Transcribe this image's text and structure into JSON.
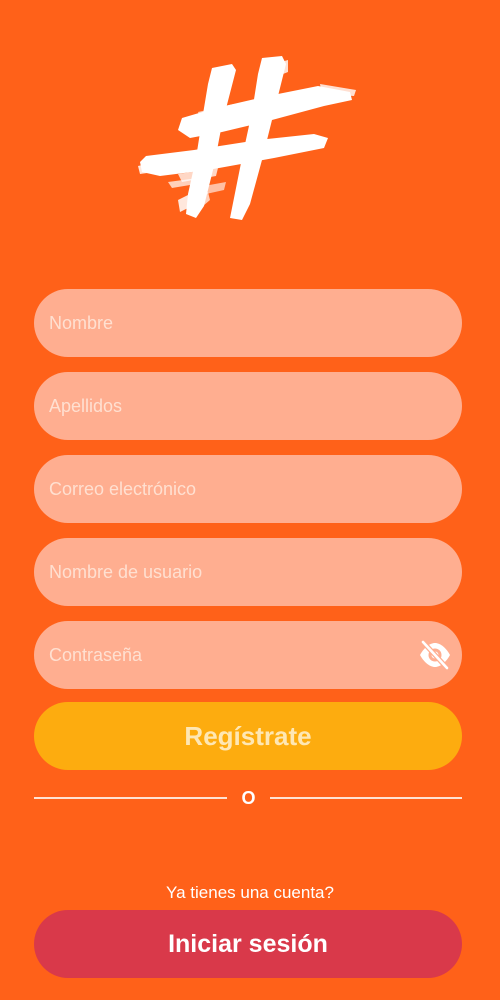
{
  "logo": {
    "icon": "hashtag-brush-logo-icon",
    "color": "#ffffff"
  },
  "form": {
    "first_name": {
      "placeholder": "Nombre",
      "value": ""
    },
    "last_name": {
      "placeholder": "Apellidos",
      "value": ""
    },
    "email": {
      "placeholder": "Correo electrónico",
      "value": ""
    },
    "username": {
      "placeholder": "Nombre de usuario",
      "value": ""
    },
    "password": {
      "placeholder": "Contraseña",
      "value": "",
      "toggle_icon": "eye-off-icon"
    }
  },
  "actions": {
    "register_label": "Regístrate",
    "divider_label": "O",
    "have_account_text": "Ya tienes una cuenta?",
    "login_label": "Iniciar sesión"
  },
  "colors": {
    "background": "#ff6119",
    "field": "#ffae90",
    "register_button": "#fdac0f",
    "login_button": "#d9394a"
  }
}
